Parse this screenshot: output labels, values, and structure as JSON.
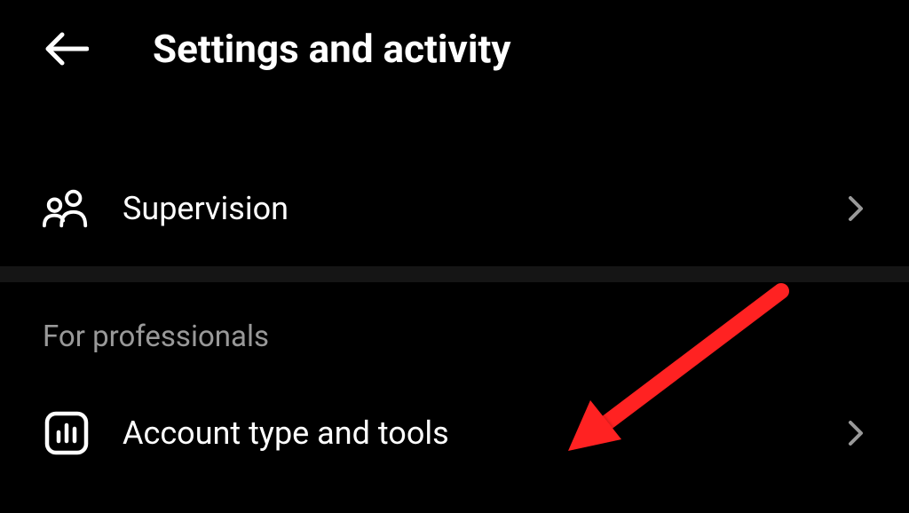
{
  "header": {
    "title": "Settings and activity"
  },
  "items": {
    "supervision": {
      "label": "Supervision"
    }
  },
  "sections": {
    "professionals": {
      "header": "For professionals",
      "account_tools": {
        "label": "Account type and tools"
      }
    }
  }
}
